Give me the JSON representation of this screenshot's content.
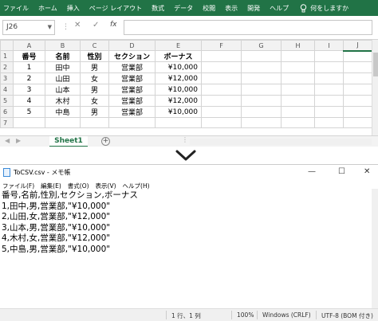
{
  "excel": {
    "ribbon_tabs": [
      "ファイル",
      "ホーム",
      "挿入",
      "ページ レイアウト",
      "数式",
      "データ",
      "校閲",
      "表示",
      "開発",
      "ヘルプ"
    ],
    "search_label": "何をしますか",
    "name_box": "J26",
    "fx_label": "fx",
    "formula": "",
    "columns": [
      "A",
      "B",
      "C",
      "D",
      "E",
      "F",
      "G",
      "H",
      "I",
      "J"
    ],
    "row_numbers": [
      "1",
      "2",
      "3",
      "4",
      "5",
      "6",
      "7"
    ],
    "headers": [
      "番号",
      "名前",
      "性別",
      "セクション",
      "ボーナス"
    ],
    "rows": [
      [
        "1",
        "田中",
        "男",
        "営業部",
        "¥10,000"
      ],
      [
        "2",
        "山田",
        "女",
        "営業部",
        "¥12,000"
      ],
      [
        "3",
        "山本",
        "男",
        "営業部",
        "¥10,000"
      ],
      [
        "4",
        "木村",
        "女",
        "営業部",
        "¥12,000"
      ],
      [
        "5",
        "中島",
        "男",
        "営業部",
        "¥10,000"
      ]
    ],
    "sheet_tab": "Sheet1",
    "add_sheet": "+"
  },
  "notepad": {
    "title": "ToCSV.csv - メモ帳",
    "menu": [
      "ファイル(F)",
      "編集(E)",
      "書式(O)",
      "表示(V)",
      "ヘルプ(H)"
    ],
    "lines": [
      "番号,名前,性別,セクション,ボーナス",
      "1,田中,男,営業部,\"¥10,000\"",
      "2,山田,女,営業部,\"¥12,000\"",
      "3,山本,男,営業部,\"¥10,000\"",
      "4,木村,女,営業部,\"¥12,000\"",
      "5,中島,男,営業部,\"¥10,000\""
    ],
    "status": {
      "position": "1 行、1 列",
      "zoom": "100%",
      "line_ending": "Windows (CRLF)",
      "encoding": "UTF-8 (BOM 付き)"
    }
  },
  "colors": {
    "excel_green": "#217346",
    "notepad_icon": "#3a8ad8"
  }
}
